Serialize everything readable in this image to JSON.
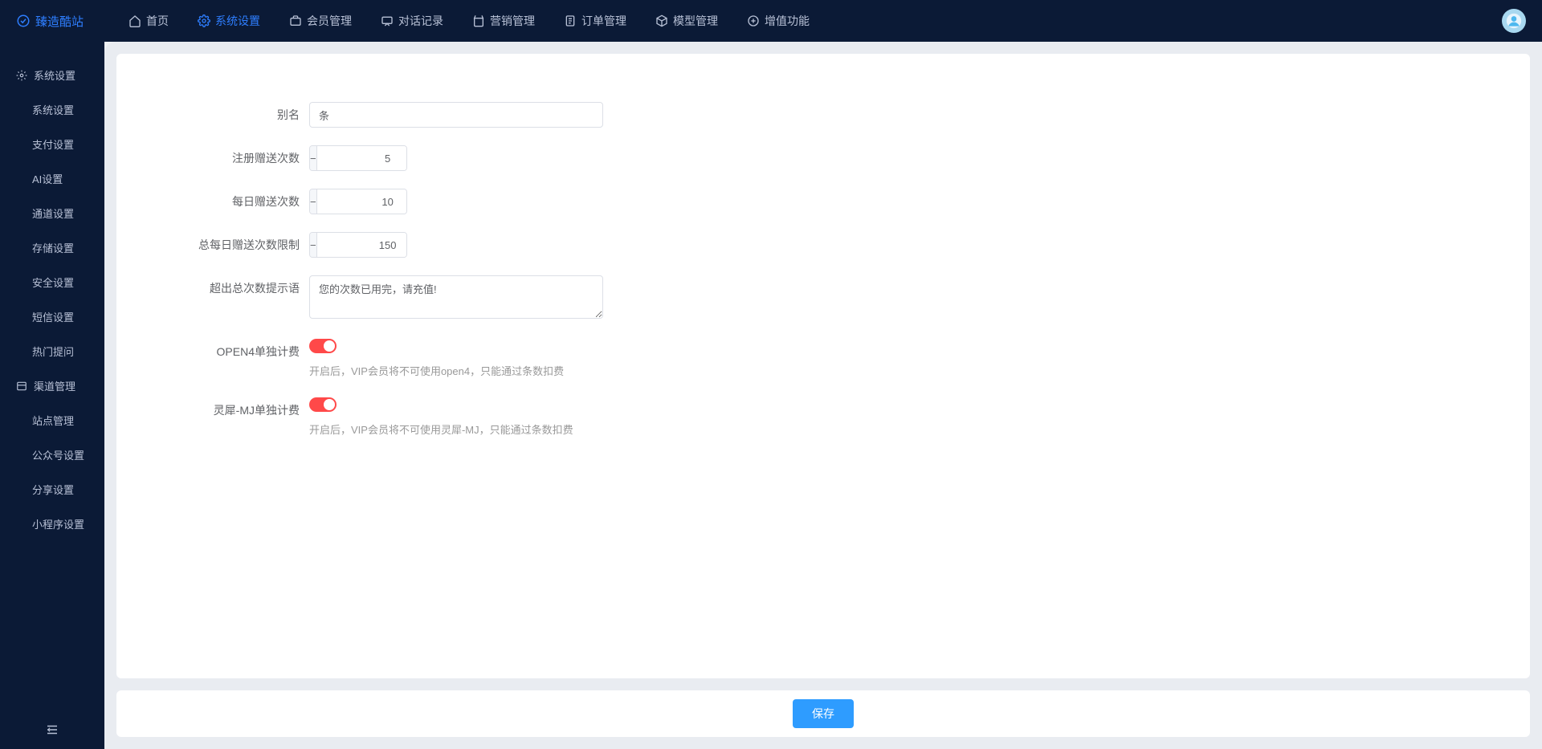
{
  "brand": "臻造酷站",
  "nav": [
    {
      "label": "首页",
      "icon": "home"
    },
    {
      "label": "系统设置",
      "icon": "gear",
      "active": true
    },
    {
      "label": "会员管理",
      "icon": "briefcase"
    },
    {
      "label": "对话记录",
      "icon": "chat"
    },
    {
      "label": "营销管理",
      "icon": "bag"
    },
    {
      "label": "订单管理",
      "icon": "order"
    },
    {
      "label": "模型管理",
      "icon": "cube"
    },
    {
      "label": "增值功能",
      "icon": "plus-circle"
    }
  ],
  "sidebar": {
    "groups": [
      {
        "title": "系统设置",
        "icon": "gear",
        "items": [
          "系统设置",
          "支付设置",
          "AI设置",
          "通道设置",
          "存储设置",
          "安全设置",
          "短信设置",
          "热门提问"
        ]
      },
      {
        "title": "渠道管理",
        "icon": "channel",
        "items": [
          "站点管理",
          "公众号设置",
          "分享设置",
          "小程序设置"
        ]
      }
    ]
  },
  "form": {
    "alias": {
      "label": "别名",
      "value": "条"
    },
    "register_bonus": {
      "label": "注册赠送次数",
      "value": "5"
    },
    "daily_bonus": {
      "label": "每日赠送次数",
      "value": "10"
    },
    "daily_bonus_limit": {
      "label": "总每日赠送次数限制",
      "value": "150"
    },
    "exceed_msg": {
      "label": "超出总次数提示语",
      "value": "您的次数已用完，请充值!"
    },
    "open4_billing": {
      "label": "OPEN4单独计费",
      "help": "开启后，VIP会员将不可使用open4，只能通过条数扣费"
    },
    "mj_billing": {
      "label": "灵犀-MJ单独计费",
      "help": "开启后，VIP会员将不可使用灵犀-MJ，只能通过条数扣费"
    }
  },
  "actions": {
    "save": "保存"
  }
}
